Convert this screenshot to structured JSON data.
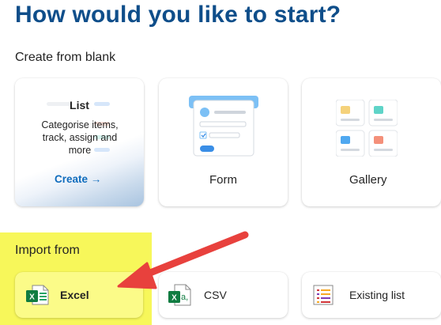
{
  "header": {
    "title": "How would you like to start?"
  },
  "blank_section": {
    "label": "Create from blank",
    "cards": {
      "list": {
        "title": "List",
        "description": "Categorise items, track, assign and more",
        "create": "Create →"
      },
      "form": {
        "label": "Form",
        "icon": "form-icon"
      },
      "gallery": {
        "label": "Gallery",
        "icon": "gallery-icon"
      }
    }
  },
  "import_section": {
    "label": "Import from",
    "cards": {
      "excel": {
        "label": "Excel",
        "icon": "excel-icon"
      },
      "csv": {
        "label": "CSV",
        "icon": "csv-icon"
      },
      "existing_list": {
        "label": "Existing list",
        "icon": "existing-list-icon"
      }
    }
  },
  "colors": {
    "title": "#0f4e8a",
    "accent": "#0f6cbd",
    "highlight": "#f7f75a",
    "annotation_arrow": "#e8413d"
  }
}
